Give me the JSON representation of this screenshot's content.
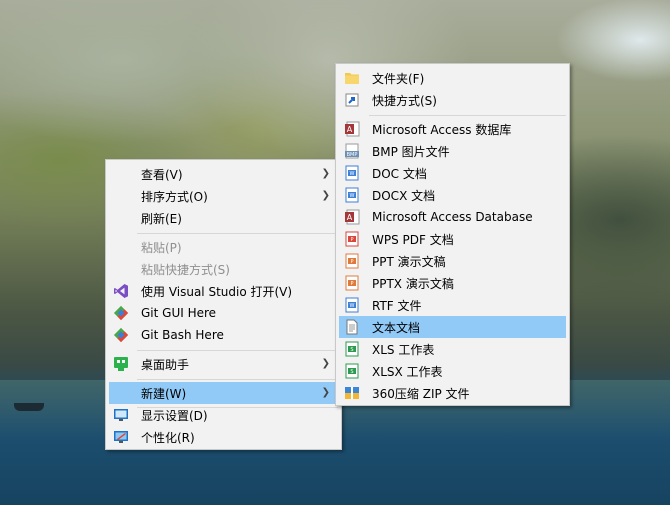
{
  "context_menu": {
    "items": [
      {
        "label": "查看(V)"
      },
      {
        "label": "排序方式(O)"
      },
      {
        "label": "刷新(E)"
      },
      {
        "label": "粘贴(P)"
      },
      {
        "label": "粘贴快捷方式(S)"
      },
      {
        "label": "使用 Visual Studio 打开(V)"
      },
      {
        "label": "Git GUI Here"
      },
      {
        "label": "Git Bash Here"
      },
      {
        "label": "桌面助手"
      },
      {
        "label": "新建(W)"
      },
      {
        "label": "显示设置(D)"
      },
      {
        "label": "个性化(R)"
      }
    ]
  },
  "new_submenu": {
    "items": [
      {
        "label": "文件夹(F)",
        "icon": "folder-icon"
      },
      {
        "label": "快捷方式(S)",
        "icon": "shortcut-icon"
      },
      {
        "label": "Microsoft Access 数据库",
        "icon": "access-icon"
      },
      {
        "label": "BMP 图片文件",
        "icon": "bmp-icon"
      },
      {
        "label": "DOC 文档",
        "icon": "doc-icon"
      },
      {
        "label": "DOCX 文档",
        "icon": "docx-icon"
      },
      {
        "label": "Microsoft Access Database",
        "icon": "access-icon"
      },
      {
        "label": "WPS PDF 文档",
        "icon": "pdf-icon"
      },
      {
        "label": "PPT 演示文稿",
        "icon": "ppt-icon"
      },
      {
        "label": "PPTX 演示文稿",
        "icon": "pptx-icon"
      },
      {
        "label": "RTF 文件",
        "icon": "rtf-icon"
      },
      {
        "label": "文本文档",
        "icon": "text-document-icon"
      },
      {
        "label": "XLS 工作表",
        "icon": "xls-icon"
      },
      {
        "label": "XLSX 工作表",
        "icon": "xlsx-icon"
      },
      {
        "label": "360压缩 ZIP 文件",
        "icon": "zip-icon"
      }
    ]
  },
  "colors": {
    "menu_background": "#f2f2f2",
    "highlight": "#91c9f7",
    "disabled_text": "#8f8f8f"
  }
}
